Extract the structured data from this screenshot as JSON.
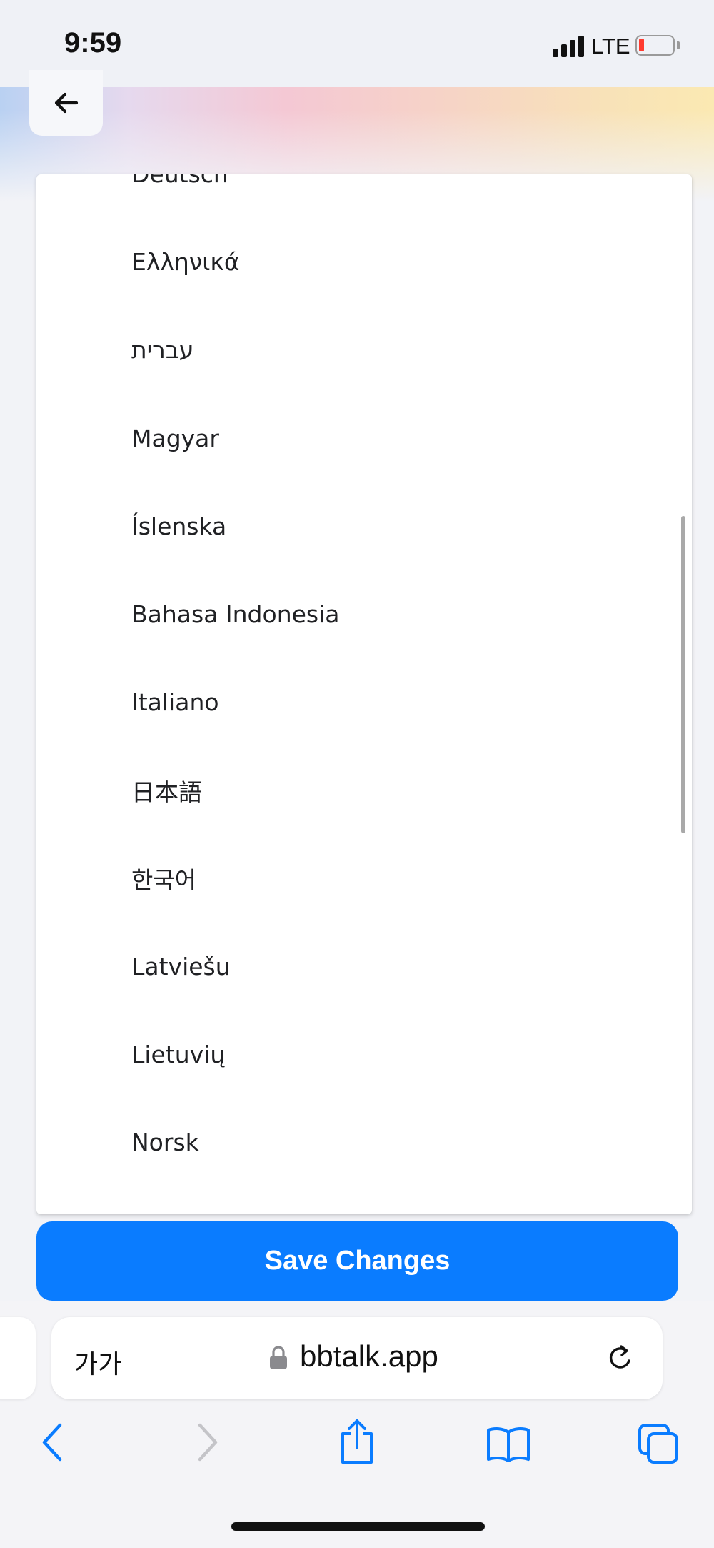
{
  "status_bar": {
    "time": "9:59",
    "network": "LTE",
    "battery_level": 0.1,
    "battery_color": "#ff3b30"
  },
  "header": {
    "back_icon": "arrow-left-icon"
  },
  "languages": [
    "Deutsch",
    "Ελληνικά",
    "עברית",
    "Magyar",
    "Íslenska",
    "Bahasa Indonesia",
    "Italiano",
    "日本語",
    "한국어",
    "Latviešu",
    "Lietuvių",
    "Norsk"
  ],
  "save_button": {
    "label": "Save Changes",
    "color": "#0a7cff"
  },
  "browser": {
    "text_size_label": "가가",
    "domain": "bbtalk.app",
    "icons": [
      "lock-icon",
      "reload-icon",
      "back-chevron-icon",
      "forward-chevron-icon",
      "share-icon",
      "bookmarks-icon",
      "tabs-icon"
    ],
    "accent": "#0a7cff"
  }
}
